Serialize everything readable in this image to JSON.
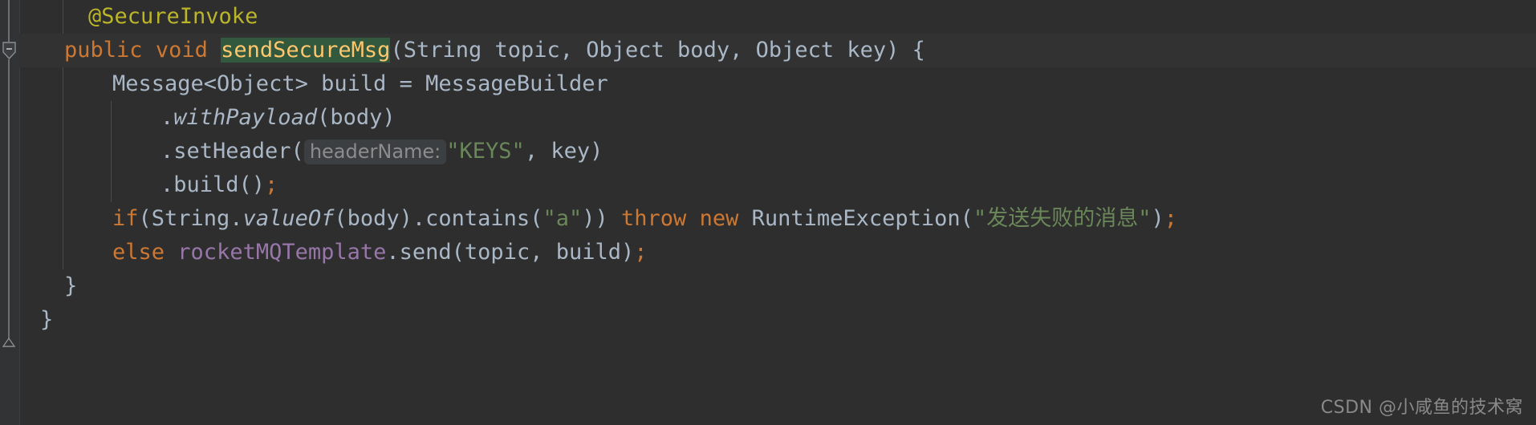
{
  "editor": {
    "theme_name": "darcula",
    "background": "#2e2e2e",
    "gutter_background": "#313335",
    "selection_color": "#32593d",
    "current_line_color": "#323232",
    "colors": {
      "keyword": "#cc7832",
      "annotation": "#bbb529",
      "method_declaration": "#ffc66d",
      "string": "#6a8759",
      "field": "#9876aa",
      "plain_text": "#a9b7c6",
      "inlay_hint_text": "#8c8c8c",
      "inlay_hint_background": "#3c3f41"
    }
  },
  "gutter": {
    "fold_collapse_marker": "minus",
    "fold_end_marker": "arrow-up"
  },
  "code": {
    "lines": [
      {
        "id": "line-annotation",
        "indent": 1,
        "tokens": [
          {
            "text": "@SecureInvoke",
            "style": "anno"
          }
        ]
      },
      {
        "id": "line-method-signature",
        "indent": 0,
        "highlight": true,
        "tokens": [
          {
            "text": "public",
            "style": "kw"
          },
          {
            "text": " ",
            "style": "plain"
          },
          {
            "text": "void",
            "style": "kw"
          },
          {
            "text": " ",
            "style": "plain"
          },
          {
            "text": "sendSecureMsg",
            "style": "method",
            "selected": true
          },
          {
            "text": "(String topic, Object body, Object key) {",
            "style": "plain"
          }
        ]
      },
      {
        "id": "line-message-builder",
        "indent": 2,
        "tokens": [
          {
            "text": "Message<Object> build = MessageBuilder",
            "style": "plain"
          }
        ]
      },
      {
        "id": "line-with-payload",
        "indent": 4,
        "tokens": [
          {
            "text": ".",
            "style": "plain"
          },
          {
            "text": "withPayload",
            "style": "plain static"
          },
          {
            "text": "(body)",
            "style": "plain"
          }
        ]
      },
      {
        "id": "line-set-header",
        "indent": 4,
        "tokens": [
          {
            "text": ".setHeader(",
            "style": "plain"
          },
          {
            "text": "headerName:",
            "style": "hint"
          },
          {
            "text": "\"KEYS\"",
            "style": "str"
          },
          {
            "text": ", key)",
            "style": "plain"
          }
        ]
      },
      {
        "id": "line-build",
        "indent": 4,
        "tokens": [
          {
            "text": ".build()",
            "style": "plain"
          },
          {
            "text": ";",
            "style": "kw"
          }
        ]
      },
      {
        "id": "line-if-throw",
        "indent": 2,
        "tokens": [
          {
            "text": "if",
            "style": "kw"
          },
          {
            "text": "(String.",
            "style": "plain"
          },
          {
            "text": "valueOf",
            "style": "plain static"
          },
          {
            "text": "(body).contains(",
            "style": "plain"
          },
          {
            "text": "\"a\"",
            "style": "str"
          },
          {
            "text": ")) ",
            "style": "plain"
          },
          {
            "text": "throw",
            "style": "kw"
          },
          {
            "text": " ",
            "style": "plain"
          },
          {
            "text": "new",
            "style": "kw"
          },
          {
            "text": " RuntimeException(",
            "style": "plain"
          },
          {
            "text": "\"发送失败的消息\"",
            "style": "str"
          },
          {
            "text": ")",
            "style": "plain"
          },
          {
            "text": ";",
            "style": "kw"
          }
        ]
      },
      {
        "id": "line-else-send",
        "indent": 2,
        "tokens": [
          {
            "text": "else",
            "style": "kw"
          },
          {
            "text": " ",
            "style": "plain"
          },
          {
            "text": "rocketMQTemplate",
            "style": "field"
          },
          {
            "text": ".send(topic, build)",
            "style": "plain"
          },
          {
            "text": ";",
            "style": "kw"
          }
        ]
      },
      {
        "id": "line-close-method",
        "indent": 0,
        "tokens": [
          {
            "text": "}",
            "style": "plain"
          }
        ]
      },
      {
        "id": "line-close-class",
        "indent": -1,
        "tokens": [
          {
            "text": "}",
            "style": "plain"
          }
        ]
      }
    ]
  },
  "watermark": {
    "text": "CSDN @小咸鱼的技术窝"
  }
}
